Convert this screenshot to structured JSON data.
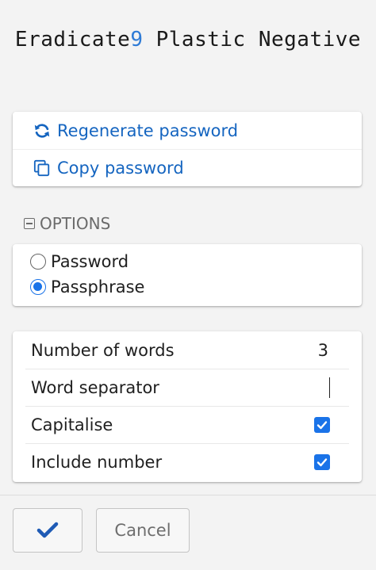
{
  "password": {
    "part1": "Eradicate",
    "digit": "9",
    "part2": " Plastic Negative"
  },
  "actions": {
    "regenerate_label": "Regenerate password",
    "copy_label": "Copy password"
  },
  "options": {
    "header_label": "OPTIONS",
    "types": [
      {
        "label": "Password",
        "checked": false
      },
      {
        "label": "Passphrase",
        "checked": true
      }
    ],
    "settings": {
      "number_of_words_label": "Number of words",
      "number_of_words_value": "3",
      "word_separator_label": "Word separator",
      "word_separator_value": "",
      "capitalise_label": "Capitalise",
      "capitalise_checked": true,
      "include_number_label": "Include number",
      "include_number_checked": true
    }
  },
  "footer": {
    "cancel_label": "Cancel"
  },
  "colors": {
    "accent": "#1a73e8",
    "link": "#1565c0",
    "digit": "#2e7bd6"
  }
}
